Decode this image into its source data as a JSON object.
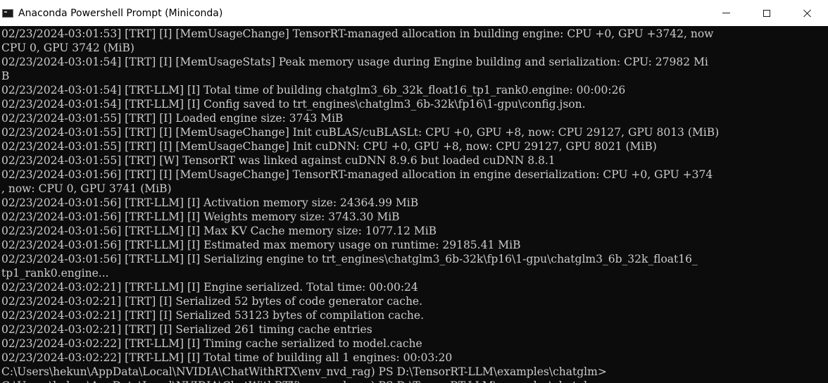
{
  "window": {
    "title": "Anaconda Powershell Prompt (Miniconda)",
    "icon": "terminal-icon"
  },
  "console": {
    "lines": [
      "02/23/2024-03:01:53] [TRT] [I] [MemUsageChange] TensorRT-managed allocation in building engine: CPU +0, GPU +3742, now",
      "CPU 0, GPU 3742 (MiB)",
      "02/23/2024-03:01:54] [TRT] [I] [MemUsageStats] Peak memory usage during Engine building and serialization: CPU: 27982 Mi",
      "B",
      "02/23/2024-03:01:54] [TRT-LLM] [I] Total time of building chatglm3_6b_32k_float16_tp1_rank0.engine: 00:00:26",
      "02/23/2024-03:01:54] [TRT-LLM] [I] Config saved to trt_engines\\chatglm3_6b-32k\\fp16\\1-gpu\\config.json.",
      "02/23/2024-03:01:55] [TRT] [I] Loaded engine size: 3743 MiB",
      "02/23/2024-03:01:55] [TRT] [I] [MemUsageChange] Init cuBLAS/cuBLASLt: CPU +0, GPU +8, now: CPU 29127, GPU 8013 (MiB)",
      "02/23/2024-03:01:55] [TRT] [I] [MemUsageChange] Init cuDNN: CPU +0, GPU +8, now: CPU 29127, GPU 8021 (MiB)",
      "02/23/2024-03:01:55] [TRT] [W] TensorRT was linked against cuDNN 8.9.6 but loaded cuDNN 8.8.1",
      "02/23/2024-03:01:56] [TRT] [I] [MemUsageChange] TensorRT-managed allocation in engine deserialization: CPU +0, GPU +374",
      ", now: CPU 0, GPU 3741 (MiB)",
      "02/23/2024-03:01:56] [TRT-LLM] [I] Activation memory size: 24364.99 MiB",
      "02/23/2024-03:01:56] [TRT-LLM] [I] Weights memory size: 3743.30 MiB",
      "02/23/2024-03:01:56] [TRT-LLM] [I] Max KV Cache memory size: 1077.12 MiB",
      "02/23/2024-03:01:56] [TRT-LLM] [I] Estimated max memory usage on runtime: 29185.41 MiB",
      "02/23/2024-03:01:56] [TRT-LLM] [I] Serializing engine to trt_engines\\chatglm3_6b-32k\\fp16\\1-gpu\\chatglm3_6b_32k_float16_",
      "tp1_rank0.engine...",
      "02/23/2024-03:02:21] [TRT-LLM] [I] Engine serialized. Total time: 00:00:24",
      "02/23/2024-03:02:21] [TRT] [I] Serialized 52 bytes of code generator cache.",
      "02/23/2024-03:02:21] [TRT] [I] Serialized 53123 bytes of compilation cache.",
      "02/23/2024-03:02:21] [TRT] [I] Serialized 261 timing cache entries",
      "02/23/2024-03:02:22] [TRT-LLM] [I] Timing cache serialized to model.cache",
      "02/23/2024-03:02:22] [TRT-LLM] [I] Total time of building all 1 engines: 00:03:20",
      "C:\\Users\\hekun\\AppData\\Local\\NVIDIA\\ChatWithRTX\\env_nvd_rag) PS D:\\TensorRT-LLM\\examples\\chatglm>",
      "C:\\Users\\hekun\\AppData\\Local\\NVIDIA\\ChatWithRTX\\env_nvd_rag) PS D:\\TensorRT-LLM\\examples\\chatglm>"
    ]
  }
}
